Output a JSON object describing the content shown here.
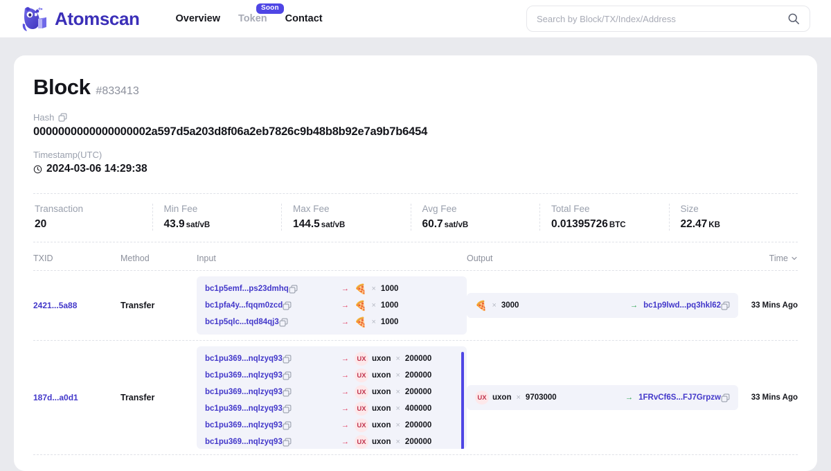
{
  "header": {
    "brand": "Atomscan",
    "logo_icon": "owl-book-logo",
    "nav": [
      {
        "label": "Overview",
        "muted": false,
        "badge": null
      },
      {
        "label": "Token",
        "muted": true,
        "badge": "Soon"
      },
      {
        "label": "Contact",
        "muted": false,
        "badge": null
      }
    ],
    "search": {
      "placeholder": "Search by Block/TX/Index/Address",
      "value": "",
      "icon": "search-icon"
    }
  },
  "block": {
    "title": "Block",
    "number": "#833413",
    "hash_label": "Hash",
    "hash": "0000000000000000002a597d5a203d8f06a2eb7826c9b48b8b92e7a9b7b6454",
    "timestamp_label": "Timestamp(UTC)",
    "timestamp": "2024-03-06 14:29:38"
  },
  "stats": [
    {
      "label": "Transaction",
      "value": "20",
      "unit": ""
    },
    {
      "label": "Min Fee",
      "value": "43.9",
      "unit": "sat/vB"
    },
    {
      "label": "Max Fee",
      "value": "144.5",
      "unit": "sat/vB"
    },
    {
      "label": "Avg Fee",
      "value": "60.7",
      "unit": "sat/vB"
    },
    {
      "label": "Total Fee",
      "value": "0.01395726",
      "unit": "BTC"
    },
    {
      "label": "Size",
      "value": "22.47",
      "unit": "KB"
    }
  ],
  "table": {
    "columns": {
      "txid": "TXID",
      "method": "Method",
      "input": "Input",
      "output": "Output",
      "time": "Time"
    },
    "rows": [
      {
        "txid": "2421...5a88",
        "method": "Transfer",
        "time": "33 Mins Ago",
        "scrollable": false,
        "inputs": [
          {
            "address": "bc1p5emf...ps23dmhq",
            "token_icon": "pizza",
            "ticker": "",
            "amount": "1000"
          },
          {
            "address": "bc1pfa4y...fqqm0zcd",
            "token_icon": "pizza",
            "ticker": "",
            "amount": "1000"
          },
          {
            "address": "bc1p5qlc...tqd84qj3",
            "token_icon": "pizza",
            "ticker": "",
            "amount": "1000"
          }
        ],
        "outputs": [
          {
            "address": "bc1p9lwd...pq3hkl62",
            "token_icon": "pizza",
            "ticker": "",
            "amount": "3000"
          }
        ]
      },
      {
        "txid": "187d...a0d1",
        "method": "Transfer",
        "time": "33 Mins Ago",
        "scrollable": true,
        "inputs": [
          {
            "address": "bc1pu369...nqlzyq93",
            "token_icon": "ux",
            "ticker": "uxon",
            "amount": "200000"
          },
          {
            "address": "bc1pu369...nqlzyq93",
            "token_icon": "ux",
            "ticker": "uxon",
            "amount": "200000"
          },
          {
            "address": "bc1pu369...nqlzyq93",
            "token_icon": "ux",
            "ticker": "uxon",
            "amount": "200000"
          },
          {
            "address": "bc1pu369...nqlzyq93",
            "token_icon": "ux",
            "ticker": "uxon",
            "amount": "400000"
          },
          {
            "address": "bc1pu369...nqlzyq93",
            "token_icon": "ux",
            "ticker": "uxon",
            "amount": "200000"
          },
          {
            "address": "bc1pu369...nqlzyq93",
            "token_icon": "ux",
            "ticker": "uxon",
            "amount": "200000"
          }
        ],
        "outputs": [
          {
            "address": "1FRvCf6S...FJ7Grpzw",
            "token_icon": "ux",
            "ticker": "uxon",
            "amount": "9703000"
          }
        ]
      }
    ]
  },
  "glyphs": {
    "pizza": "🍕",
    "ux": "UX",
    "arrow": "→",
    "multiply": "×",
    "chevron_down": "⌄"
  },
  "colors": {
    "brand": "#3b2fb8",
    "accent": "#4f46e5",
    "link": "#4338ca",
    "arrow_in": "#e0365b",
    "arrow_out": "#24a148",
    "page_bg": "#e9eaee",
    "io_bg": "#f2f3fa"
  }
}
